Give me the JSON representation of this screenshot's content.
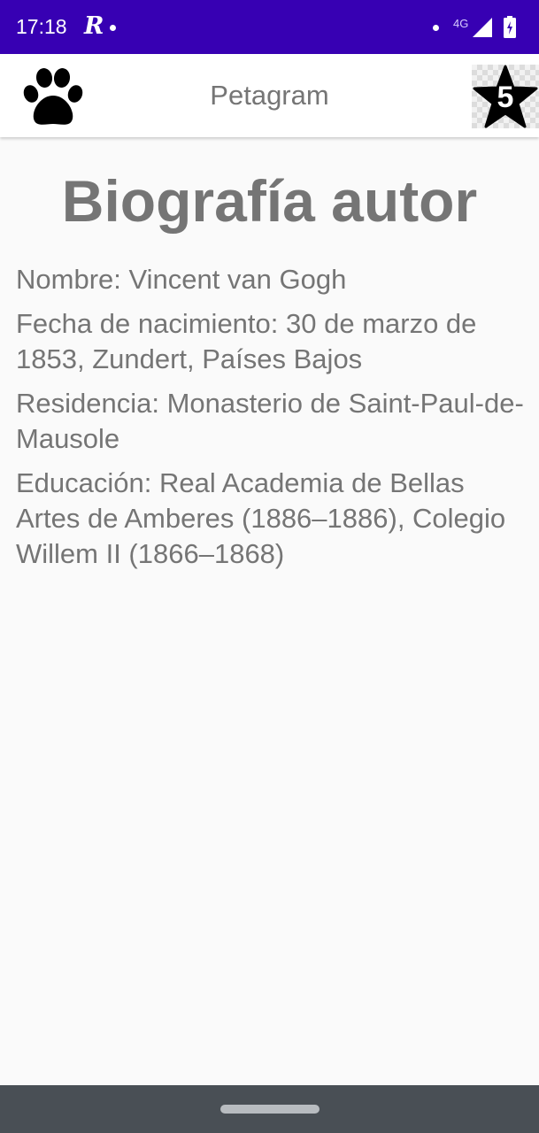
{
  "status_bar": {
    "time": "17:18",
    "app_indicator": "R",
    "network": "4G",
    "signal_icon": "signal-icon",
    "battery_icon": "battery-icon",
    "color": "#3700b3"
  },
  "app_bar": {
    "logo_icon": "paw-icon",
    "title": "Petagram",
    "badge_icon": "star-icon",
    "badge_count": "5"
  },
  "content": {
    "title": "Biografía autor",
    "items": [
      {
        "text": "Nombre: Vincent van Gogh"
      },
      {
        "text": "Fecha de nacimiento: 30 de marzo de 1853, Zundert, Países Bajos"
      },
      {
        "text": "Residencia: Monasterio de Saint-Paul-de-Mausole"
      },
      {
        "text": "Educación: Real Academia de Bellas Artes de Amberes (1886–1886), Colegio Willem II (1866–1868)"
      }
    ]
  },
  "colors": {
    "primary_dark": "#3700b3",
    "text_gray": "#757575",
    "nav_bar": "#494f55"
  }
}
